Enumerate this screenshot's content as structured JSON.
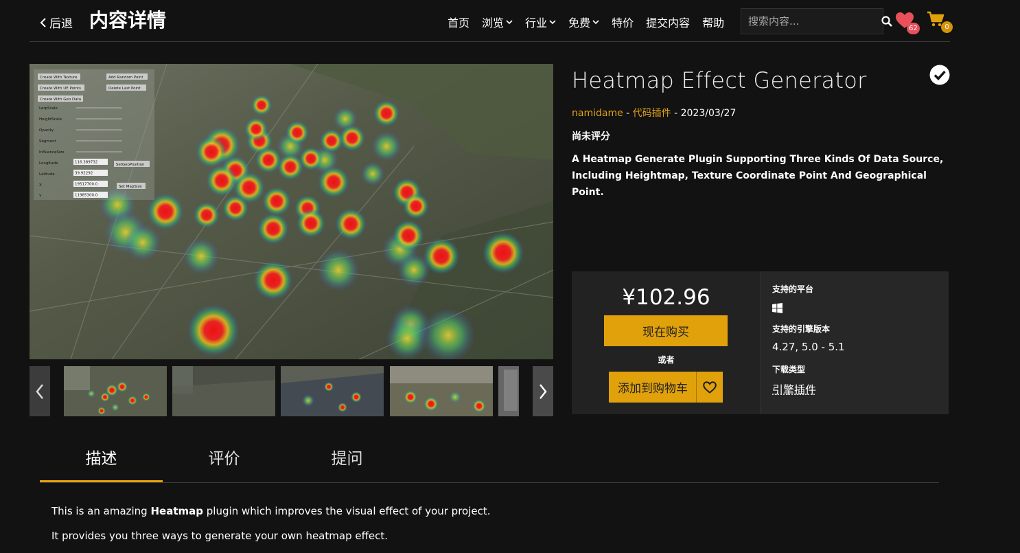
{
  "header": {
    "back_label": "后退",
    "page_title": "内容详情",
    "nav": [
      {
        "label": "首页",
        "dropdown": false
      },
      {
        "label": "浏览",
        "dropdown": true
      },
      {
        "label": "行业",
        "dropdown": true
      },
      {
        "label": "免费",
        "dropdown": true
      },
      {
        "label": "特价",
        "dropdown": false
      },
      {
        "label": "提交内容",
        "dropdown": false
      },
      {
        "label": "帮助",
        "dropdown": false
      }
    ],
    "search_placeholder": "搜索内容...",
    "favorites_count": "62",
    "cart_count": "0"
  },
  "product": {
    "title": "Heatmap Effect Generator",
    "author": "namidame",
    "separator": " - ",
    "category": "代码插件",
    "date": "2023/03/27",
    "rating": "尚未评分",
    "description": "A Heatmap Generate Plugin Supporting Three Kinds Of Data Source, Including Heightmap, Texture Coordinate Point And Geographical Point."
  },
  "hero_ui": {
    "buttons": [
      "Create With Texture",
      "Create With UE Points",
      "Create With Geo Data",
      "Add Random Point",
      "Delete Last Point",
      "SetGeoPosition",
      "Set MapSize"
    ],
    "labels": [
      "LerpScale",
      "HeightScale",
      "Opacity",
      "Segment",
      "InfluenceSize",
      "Longitude",
      "Latitude",
      "X",
      "Y"
    ],
    "values": [
      "116.389732",
      "39.92292",
      "19517700.0",
      "11985300.0"
    ]
  },
  "purchase": {
    "price": "¥102.96",
    "buy_now_label": "现在购买",
    "or_label": "或者",
    "add_to_cart_label": "添加到购物车",
    "platform_heading": "支持的平台",
    "platform_icon": "windows-icon",
    "engine_heading": "支持的引擎版本",
    "engine_versions": "4.27, 5.0 - 5.1",
    "download_heading": "下载类型",
    "download_type": "引擎插件"
  },
  "tabs": [
    {
      "label": "描述",
      "active": true
    },
    {
      "label": "评价",
      "active": false
    },
    {
      "label": "提问",
      "active": false
    }
  ],
  "content": {
    "p1_before": "This is an amazing ",
    "p1_bold": "Heatmap",
    "p1_after": " plugin which improves the visual effect of your project.",
    "p2": "It provides you three ways to generate your own heatmap effect."
  },
  "colors": {
    "accent": "#e0a10b",
    "link": "#e0a21b",
    "background": "#121212",
    "favorite_badge": "#e8505b"
  }
}
